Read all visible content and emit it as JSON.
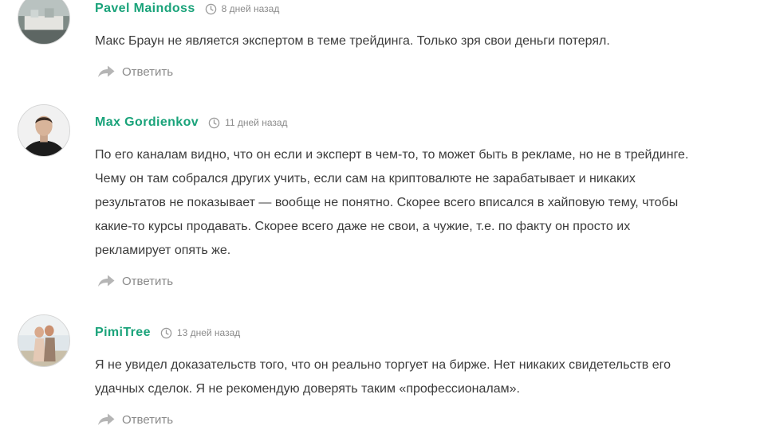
{
  "comments": [
    {
      "author": "Pavel Maindoss",
      "time": "8 дней назад",
      "lines": [
        "Макс Браун не является экспертом в теме трейдинга. Только зря свои деньги потерял."
      ],
      "reply_label": "Ответить"
    },
    {
      "author": "Max Gordienkov",
      "time": "11 дней назад",
      "lines": [
        "По его каналам видно, что он если и эксперт в чем-то, то может быть в рекламе, но не в трейдинге.",
        "Чему он там собрался других учить, если сам на криптовалюте не зарабатывает и никаких",
        "результатов не показывает — вообще не понятно. Скорее всего вписался в хайповую тему, чтобы",
        "какие-то курсы продавать. Скорее всего даже не свои, а чужие, т.е. по факту он просто их",
        "рекламирует опять же."
      ],
      "reply_label": "Ответить"
    },
    {
      "author": "PimiTree",
      "time": "13 дней назад",
      "lines": [
        "Я не увидел доказательств того, что он реально торгует на бирже. Нет никаких свидетельств его",
        "удачных сделок. Я не рекомендую доверять таким «профессионалам»."
      ],
      "reply_label": "Ответить"
    }
  ],
  "colors": {
    "author": "#1aa37a",
    "text": "#3c3c3c",
    "muted": "#8a8a8a"
  },
  "icons": {
    "time": "clock-icon",
    "reply": "reply-arrow-icon"
  }
}
